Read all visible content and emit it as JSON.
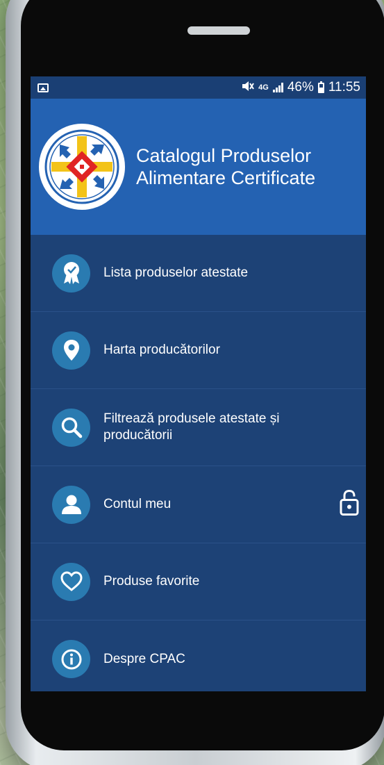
{
  "status_bar": {
    "network": "4G",
    "battery": "46%",
    "battery_level": 0.46,
    "time": "11:55"
  },
  "header": {
    "title_line1": "Catalogul Produselor",
    "title_line2": "Alimentare Certificate"
  },
  "menu": {
    "items": [
      {
        "label": "Lista produselor atestate",
        "icon": "award-ribbon-icon"
      },
      {
        "label": "Harta producătorilor",
        "icon": "map-pin-icon"
      },
      {
        "label": "Filtrează produsele atestate și producătorii",
        "icon": "search-icon"
      },
      {
        "label": "Contul meu",
        "icon": "user-icon"
      },
      {
        "label": "Produse favorite",
        "icon": "heart-icon"
      },
      {
        "label": "Despre CPAC",
        "icon": "info-icon"
      }
    ]
  },
  "colors": {
    "header_bg": "#2462b2",
    "menu_bg": "#1d4276",
    "icon_circle": "#2a7bb1",
    "status_bar_bg": "#1a3f74"
  }
}
